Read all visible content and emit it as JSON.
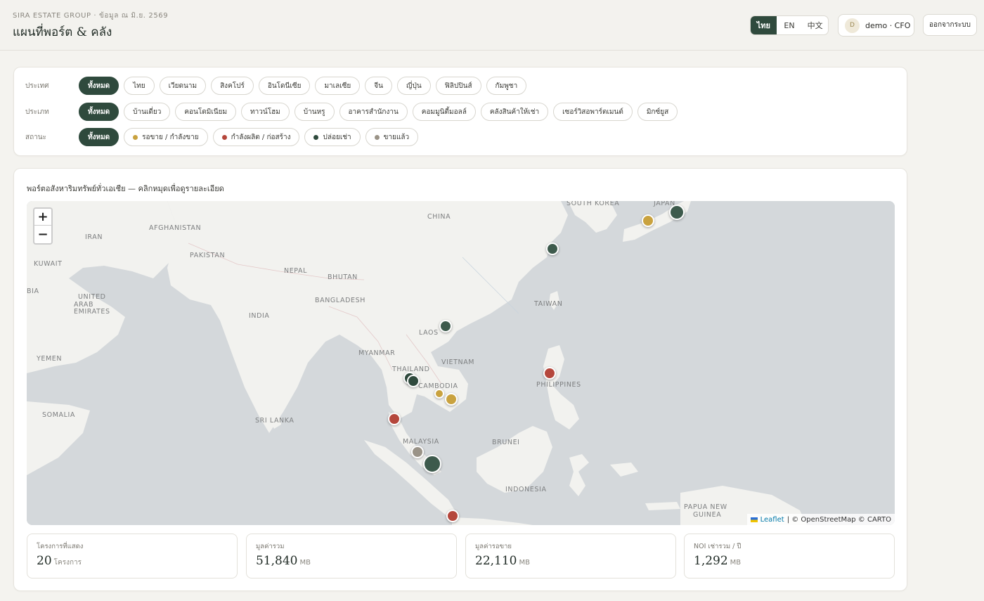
{
  "header": {
    "brand": "SIRA ESTATE GROUP · ข้อมูล ณ มิ.ย. 2569",
    "title": "แผนที่พอร์ต & คลัง",
    "languages": [
      "ไทย",
      "EN",
      "中文"
    ],
    "active_language": "ไทย",
    "user_initial": "D",
    "user_label": "demo · CFO",
    "logout_label": "ออกจากระบบ"
  },
  "filters": {
    "country": {
      "label": "ประเทศ",
      "options": [
        "ทั้งหมด",
        "ไทย",
        "เวียดนาม",
        "สิงคโปร์",
        "อินโดนีเซีย",
        "มาเลเซีย",
        "จีน",
        "ญี่ปุ่น",
        "ฟิลิปปินส์",
        "กัมพูชา"
      ],
      "selected": "ทั้งหมด"
    },
    "type": {
      "label": "ประเภท",
      "options": [
        "ทั้งหมด",
        "บ้านเดี่ยว",
        "คอนโดมิเนียม",
        "ทาวน์โฮม",
        "บ้านหรู",
        "อาคารสำนักงาน",
        "คอมมูนิตี้มอลล์",
        "คลังสินค้าให้เช่า",
        "เซอร์วิสอพาร์ตเมนต์",
        "มิกซ์ยูส"
      ],
      "selected": "ทั้งหมด"
    },
    "status": {
      "label": "สถานะ",
      "options": [
        {
          "label": "ทั้งหมด",
          "color": ""
        },
        {
          "label": "รอขาย / กำลังขาย",
          "color": "#c9a23f"
        },
        {
          "label": "กำลังผลิต / ก่อสร้าง",
          "color": "#b5473c"
        },
        {
          "label": "ปล่อยเช่า",
          "color": "#2f4a3d"
        },
        {
          "label": "ขายแล้ว",
          "color": "#9a9387"
        }
      ],
      "selected": "ทั้งหมด"
    }
  },
  "map": {
    "title": "พอร์ตอสังหาริมทรัพย์ทั่วเอเชีย — คลิกหมุดเพื่อดูรายละเอียด",
    "zoom_in": "+",
    "zoom_out": "−",
    "attribution_leaflet": "Leaflet",
    "attribution_rest": "| © OpenStreetMap © CARTO",
    "labels": [
      "CHINA",
      "SOUTH KOREA",
      "JAPAN",
      "AFGHANISTAN",
      "IRAN",
      "PAKISTAN",
      "KUWAIT",
      "NEPAL",
      "BHUTAN",
      "BIA",
      "UNITED",
      "ARAB",
      "EMIRATES",
      "BANGLADESH",
      "TAIWAN",
      "INDIA",
      "LAOS",
      "MYANMAR",
      "VIETNAM",
      "YEMEN",
      "THAILAND",
      "CAMBODIA",
      "PHILIPPINES",
      "SOMALIA",
      "SRI LANKA",
      "MALAYSIA",
      "BRUNEI",
      "INDONESIA",
      "PAPUA NEW",
      "GUINEA"
    ],
    "markers": [
      {
        "status": "ปล่อยเช่า",
        "color": "#3d5a4c",
        "size": "large"
      },
      {
        "status": "รอขาย / กำลังขาย",
        "color": "#c9a23f",
        "size": "medium"
      },
      {
        "status": "ปล่อยเช่า",
        "color": "#3d5a4c",
        "size": "medium"
      },
      {
        "status": "ปล่อยเช่า",
        "color": "#3d5a4c",
        "size": "medium"
      },
      {
        "status": "กำลังผลิต / ก่อสร้าง",
        "color": "#b5473c",
        "size": "medium"
      },
      {
        "status": "ปล่อยเช่า",
        "color": "#2f4a3d",
        "size": "medium"
      },
      {
        "status": "ปล่อยเช่า",
        "color": "#2f4a3d",
        "size": "medium"
      },
      {
        "status": "รอขาย / กำลังขาย",
        "color": "#c9a23f",
        "size": "small"
      },
      {
        "status": "รอขาย / กำลังขาย",
        "color": "#c9a23f",
        "size": "medium"
      },
      {
        "status": "กำลังผลิต / ก่อสร้าง",
        "color": "#b5473c",
        "size": "medium"
      },
      {
        "status": "ขายแล้ว",
        "color": "#9a9387",
        "size": "medium"
      },
      {
        "status": "ปล่อยเช่า",
        "color": "#3d5a4c",
        "size": "xlarge"
      },
      {
        "status": "กำลังผลิต / ก่อสร้าง",
        "color": "#b5473c",
        "size": "medium"
      }
    ]
  },
  "stats": [
    {
      "label": "โครงการที่แสดง",
      "value": "20",
      "unit": "โครงการ"
    },
    {
      "label": "มูลค่ารวม",
      "value": "51,840",
      "unit": "MB"
    },
    {
      "label": "มูลค่ารอขาย",
      "value": "22,110",
      "unit": "MB"
    },
    {
      "label": "NOI เช่ารวม / ปี",
      "value": "1,292",
      "unit": "MB"
    }
  ]
}
